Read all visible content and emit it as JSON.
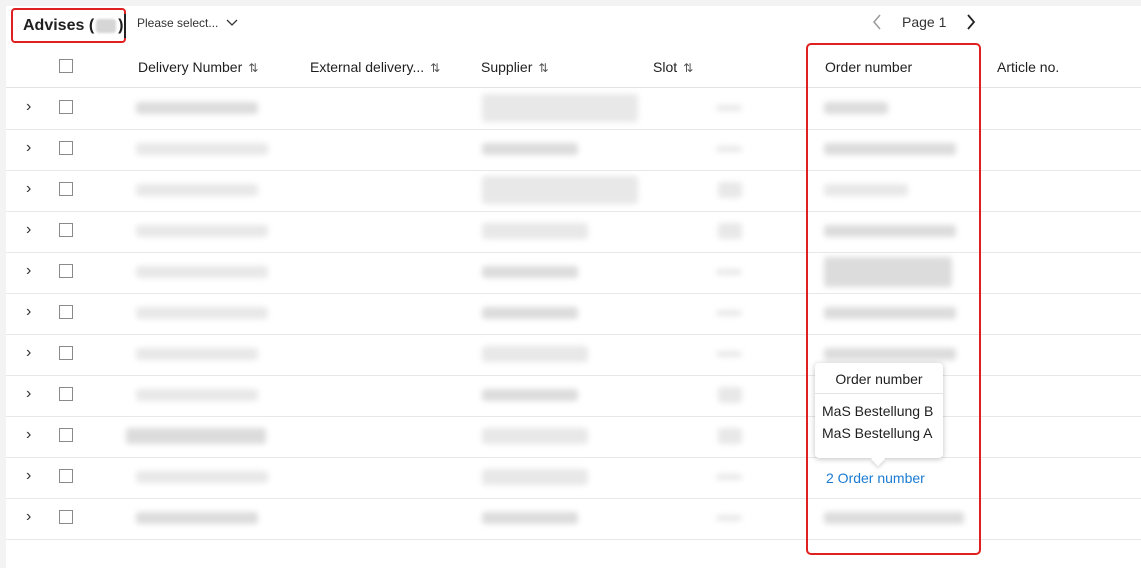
{
  "header": {
    "title_prefix": "Advises (",
    "title_suffix": ")",
    "select_placeholder": "Please select...",
    "select_icon": "chevron-down-icon",
    "pager": {
      "prev_icon": "chevron-left-icon",
      "page_label": "Page 1",
      "next_icon": "chevron-right-icon"
    }
  },
  "table": {
    "columns": [
      {
        "label": "Delivery Number",
        "sortable": true
      },
      {
        "label": "External delivery...",
        "sortable": true
      },
      {
        "label": "Supplier",
        "sortable": true
      },
      {
        "label": "Slot",
        "sortable": true
      },
      {
        "label": "Order number",
        "sortable": false
      },
      {
        "label": "Article no.",
        "sortable": false
      }
    ],
    "sort_icon": "⇅",
    "expand_icon": "›",
    "order_link_label": "2 Order number"
  },
  "tooltip": {
    "title": "Order number",
    "items": [
      "MaS Bestellung B",
      "MaS Bestellung A"
    ]
  },
  "colors": {
    "accent_link": "#1b7bd2",
    "highlight": "#e02020"
  }
}
